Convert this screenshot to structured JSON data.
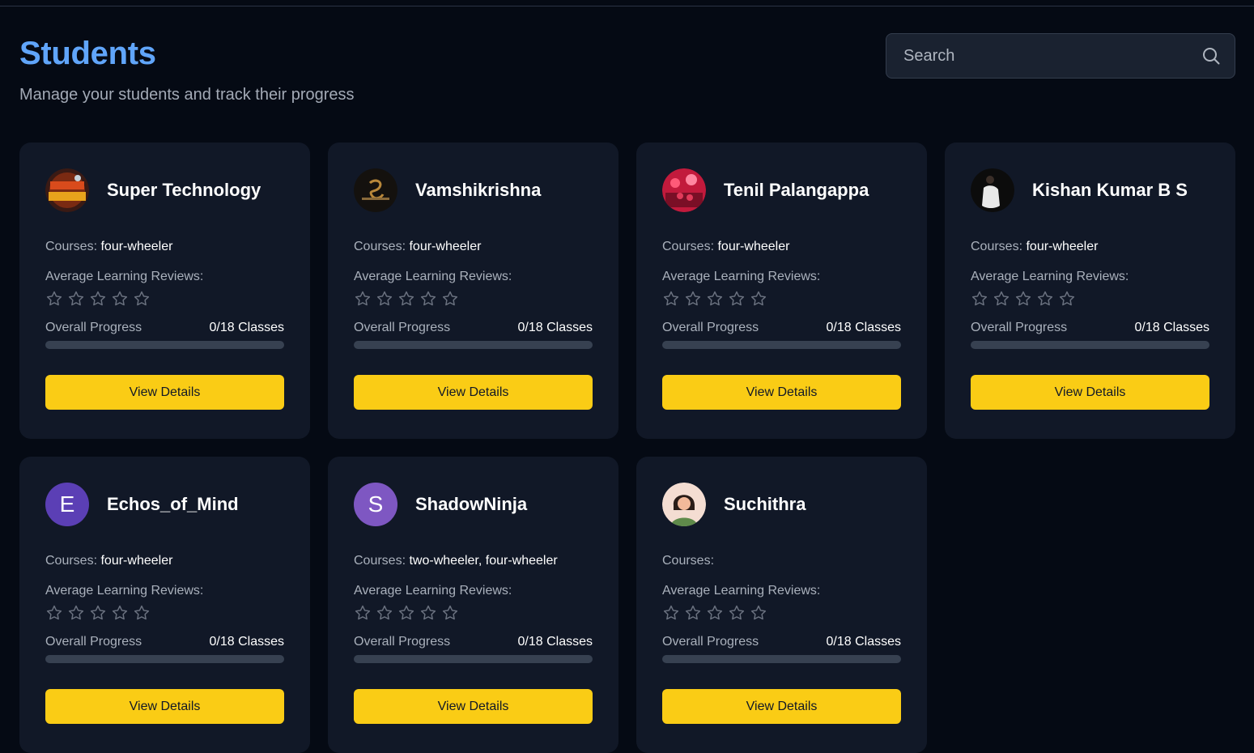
{
  "header": {
    "title": "Students",
    "subtitle": "Manage your students and track their progress"
  },
  "search": {
    "placeholder": "Search",
    "value": "",
    "icon": "search-icon"
  },
  "labels": {
    "courses": "Courses:",
    "reviews": "Average Learning Reviews:",
    "progress": "Overall Progress",
    "view_details": "View Details"
  },
  "colors": {
    "accent_title": "#60a5fa",
    "button": "#facc15",
    "card_bg": "#111827",
    "page_bg": "#050a14"
  },
  "students": [
    {
      "name": "Super Technology",
      "courses": "four-wheeler",
      "rating": 0,
      "max_rating": 5,
      "progress_text": "0/18 Classes",
      "progress": 0,
      "avatar": {
        "type": "photo",
        "icon": "super-technology-logo-avatar"
      }
    },
    {
      "name": "Vamshikrishna",
      "courses": "four-wheeler",
      "rating": 0,
      "max_rating": 5,
      "progress_text": "0/18 Classes",
      "progress": 0,
      "avatar": {
        "type": "photo",
        "icon": "outlier-logo-avatar"
      }
    },
    {
      "name": "Tenil Palangappa",
      "courses": "four-wheeler",
      "rating": 0,
      "max_rating": 5,
      "progress_text": "0/18 Classes",
      "progress": 0,
      "avatar": {
        "type": "photo",
        "icon": "crowd-photo-avatar"
      }
    },
    {
      "name": "Kishan Kumar B S",
      "courses": "four-wheeler",
      "rating": 0,
      "max_rating": 5,
      "progress_text": "0/18 Classes",
      "progress": 0,
      "avatar": {
        "type": "photo",
        "icon": "person-photo-avatar"
      }
    },
    {
      "name": "Echos_of_Mind",
      "courses": "four-wheeler",
      "rating": 0,
      "max_rating": 5,
      "progress_text": "0/18 Classes",
      "progress": 0,
      "avatar": {
        "type": "letter",
        "letter": "E",
        "color": "#5b3fb5"
      }
    },
    {
      "name": "ShadowNinja",
      "courses": "two-wheeler, four-wheeler",
      "rating": 0,
      "max_rating": 5,
      "progress_text": "0/18 Classes",
      "progress": 0,
      "avatar": {
        "type": "letter",
        "letter": "S",
        "color": "#7e57c2"
      }
    },
    {
      "name": "Suchithra",
      "courses": "",
      "rating": 0,
      "max_rating": 5,
      "progress_text": "0/18 Classes",
      "progress": 0,
      "avatar": {
        "type": "photo",
        "icon": "woman-illustration-avatar"
      }
    }
  ]
}
